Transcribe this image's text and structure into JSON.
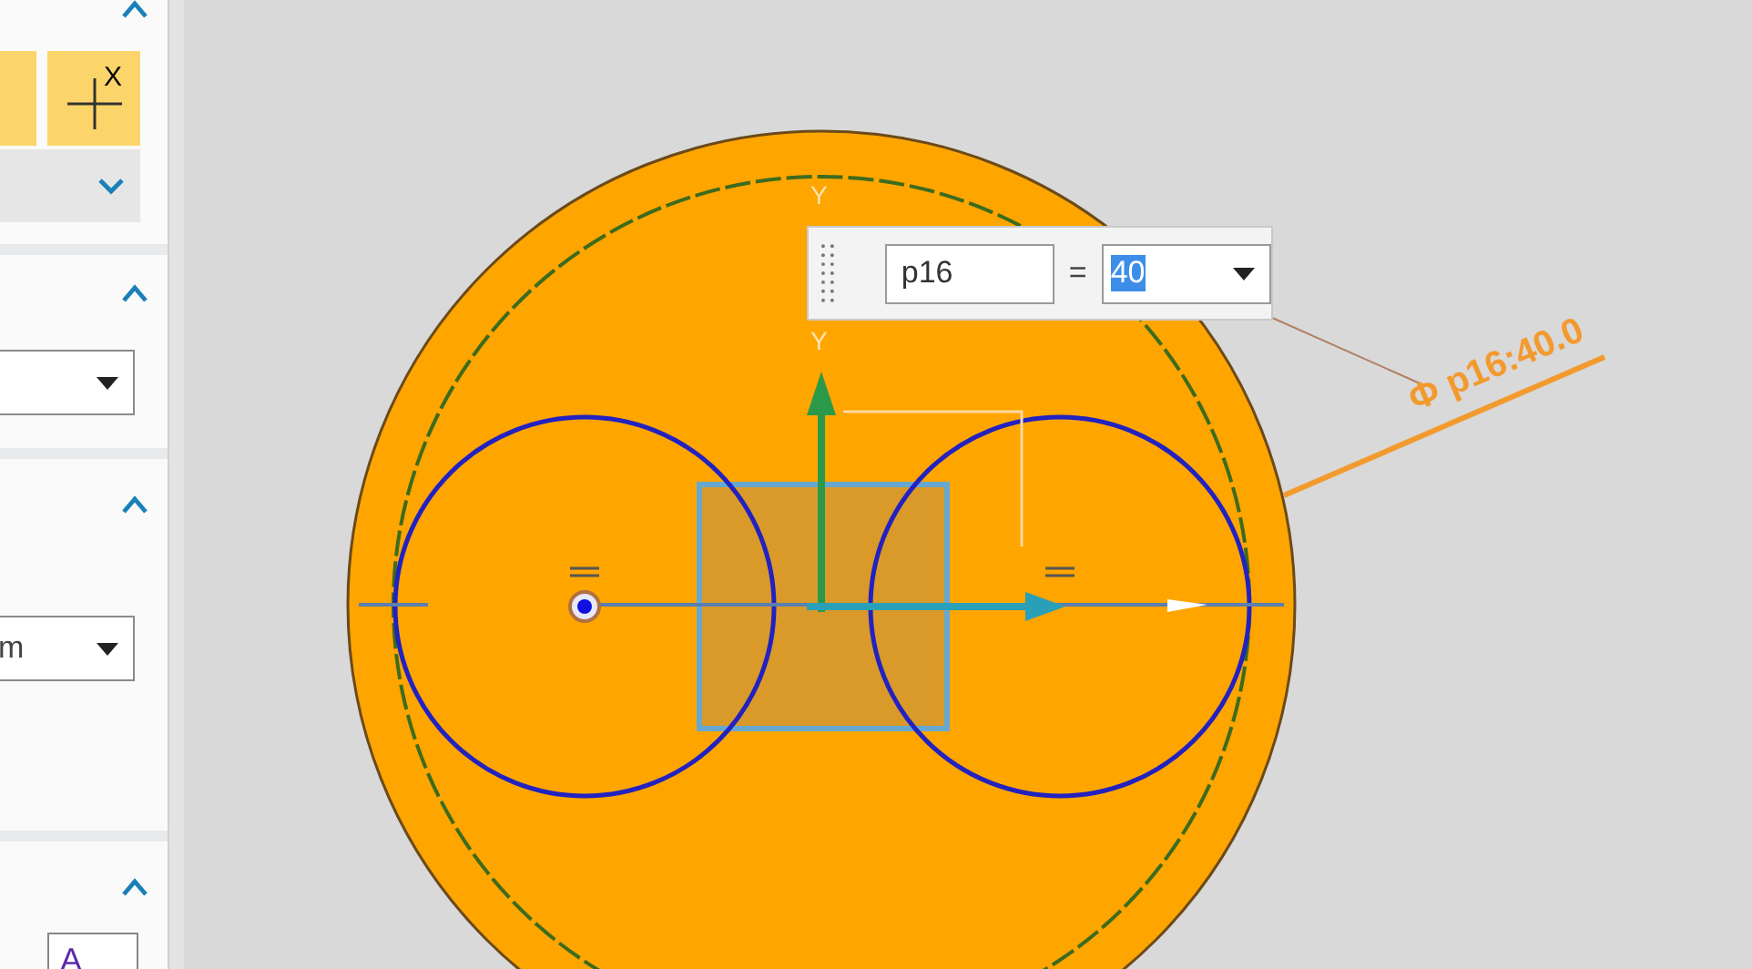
{
  "sidebar": {
    "sections": [
      {
        "kind": "tools",
        "expanded": true,
        "tools": [
          {
            "kind": "blank",
            "selected": true
          },
          {
            "kind": "axis-x",
            "label": "X",
            "selected": true
          }
        ],
        "subgroup": {
          "expanded": false
        }
      },
      {
        "kind": "dropdown",
        "expanded": true
      },
      {
        "kind": "dropdown",
        "expanded": true,
        "value": "m"
      },
      {
        "kind": "style",
        "expanded": true,
        "button_label": "A"
      }
    ]
  },
  "canvas": {
    "axis_labels": [
      "Y",
      "Y"
    ],
    "dimension_label": "Φ p16:40.0"
  },
  "expression_popup": {
    "name": "p16",
    "operator": "=",
    "value": "40",
    "value_selected": true
  }
}
